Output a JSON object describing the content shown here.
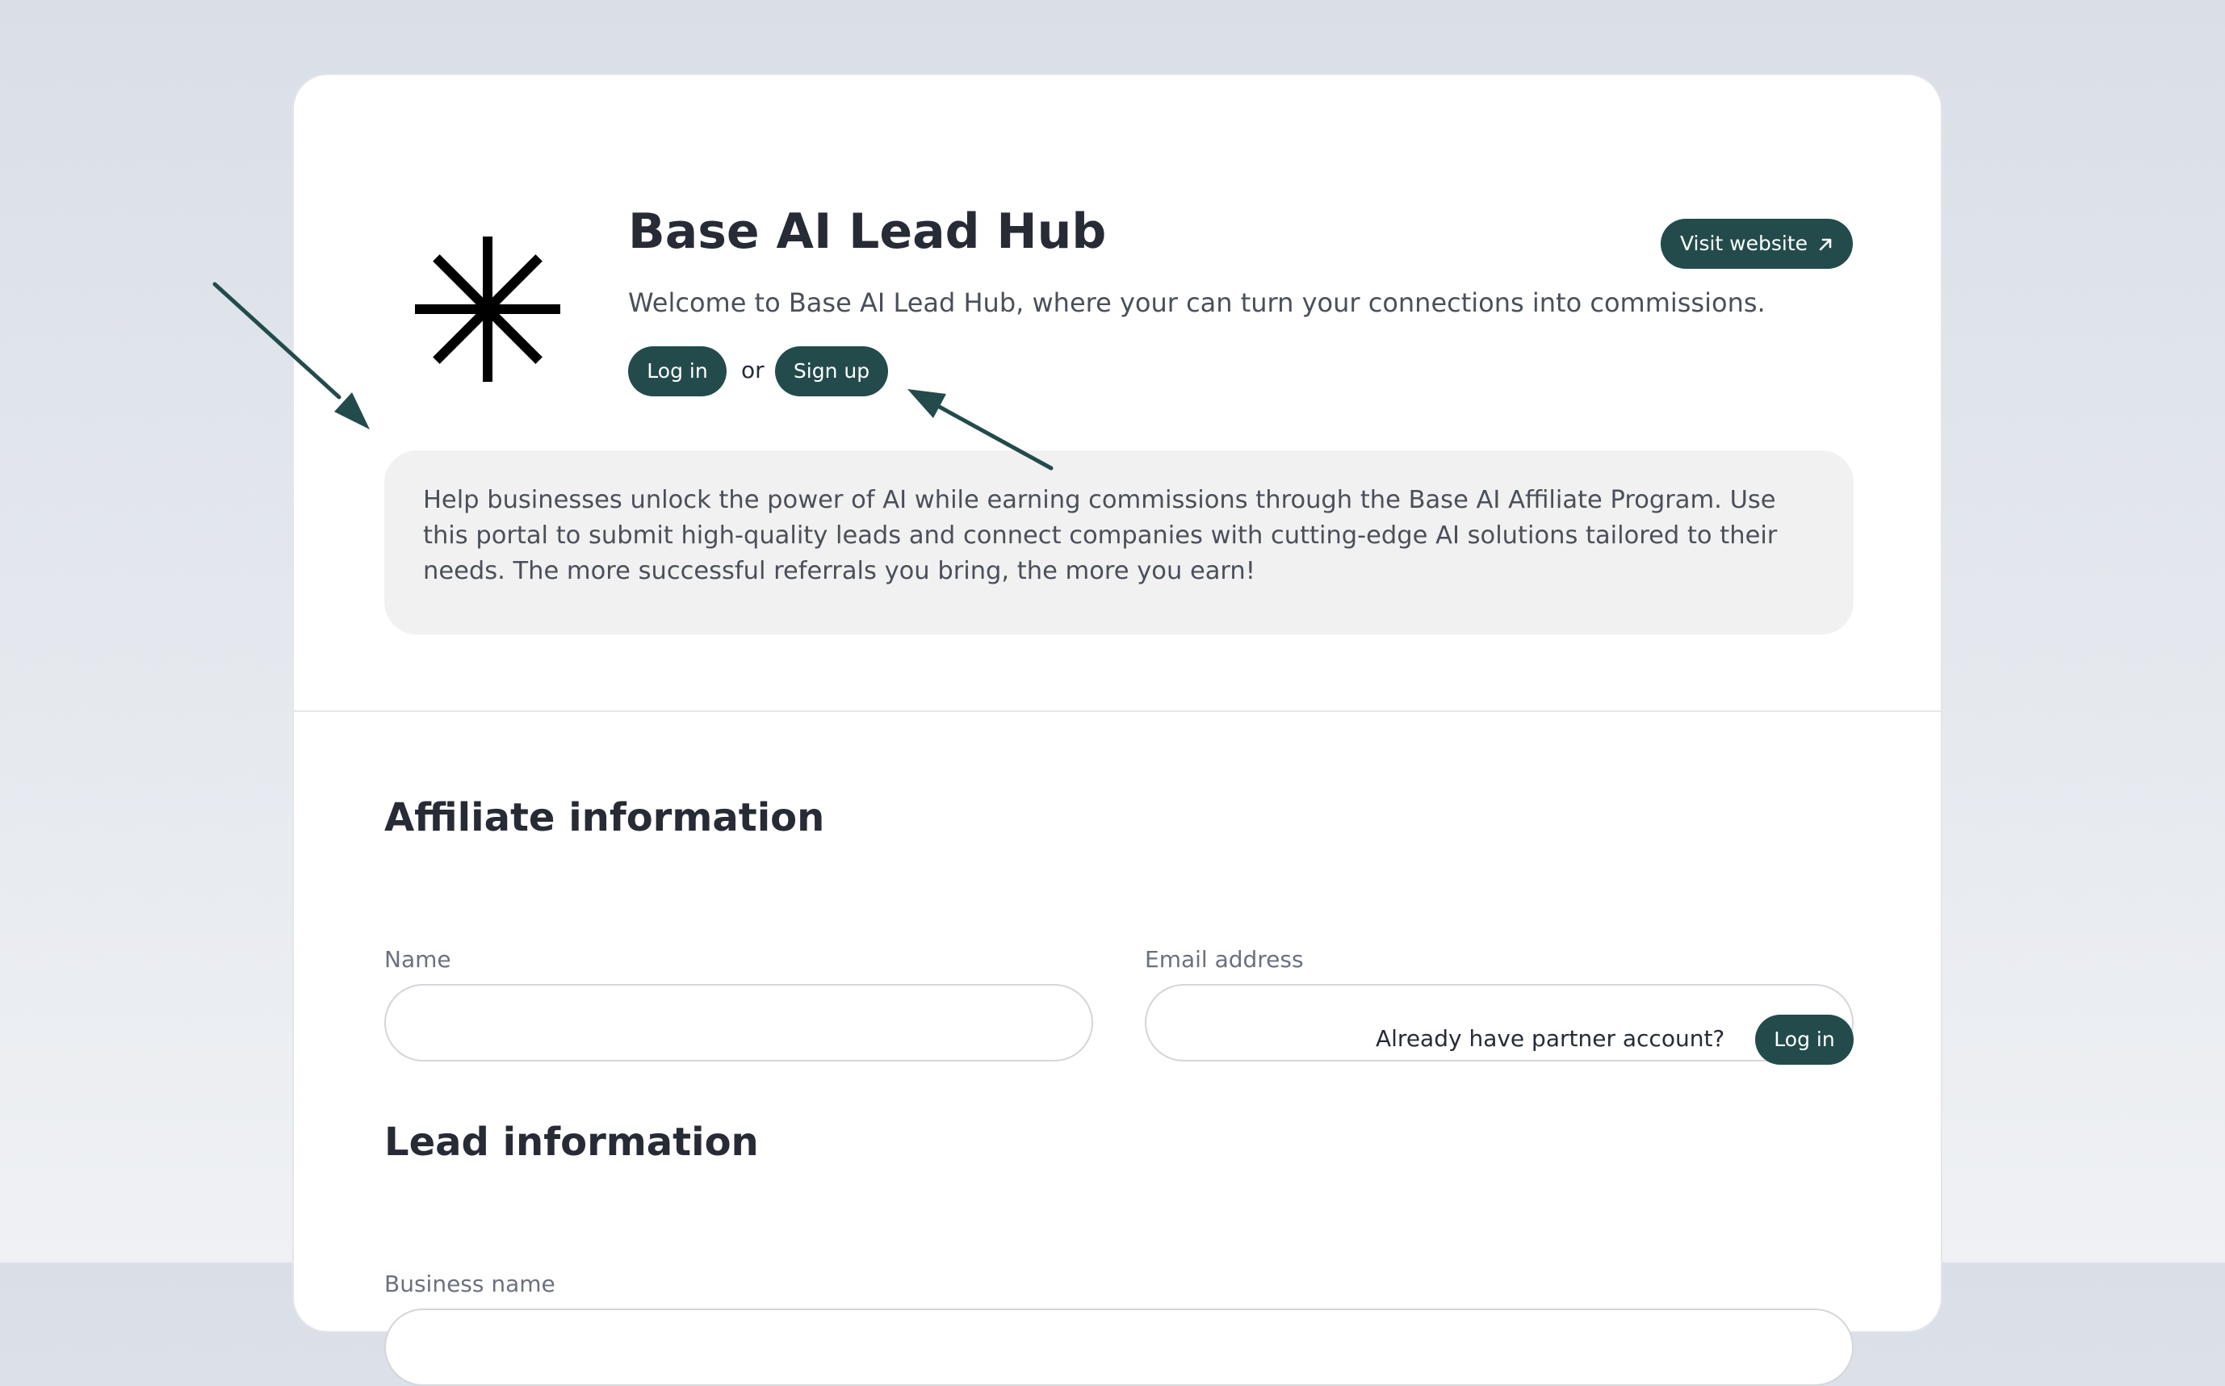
{
  "header": {
    "title": "Base AI Lead Hub",
    "subtitle": "Welcome to Base AI Lead Hub, where your can turn your connections into commissions.",
    "visit_website_label": "Visit website",
    "login_label": "Log in",
    "or_text": "or",
    "signup_label": "Sign up"
  },
  "intro": {
    "text": "Help businesses unlock the power of AI while earning commissions through the Base AI Affiliate Program. Use this portal to submit high-quality leads and connect companies with cutting-edge AI solutions tailored to their needs. The more successful referrals you bring, the more you earn!"
  },
  "affiliate": {
    "title": "Affiliate information",
    "name_label": "Name",
    "name_value": "",
    "email_label": "Email address",
    "email_value": "",
    "partner_prompt": "Already have partner account?",
    "partner_login_label": "Log in"
  },
  "lead": {
    "title": "Lead information",
    "business_name_label": "Business name",
    "business_name_value": ""
  },
  "icons": {
    "logo": "asterisk-logo-icon",
    "external_link": "arrow-up-right-icon",
    "annotation_arrows": "annotation-arrow-icon"
  },
  "colors": {
    "accent": "#234b4b",
    "card_background": "#ffffff",
    "intro_background": "#f1f1f1",
    "page_background": "#dadfe7"
  }
}
